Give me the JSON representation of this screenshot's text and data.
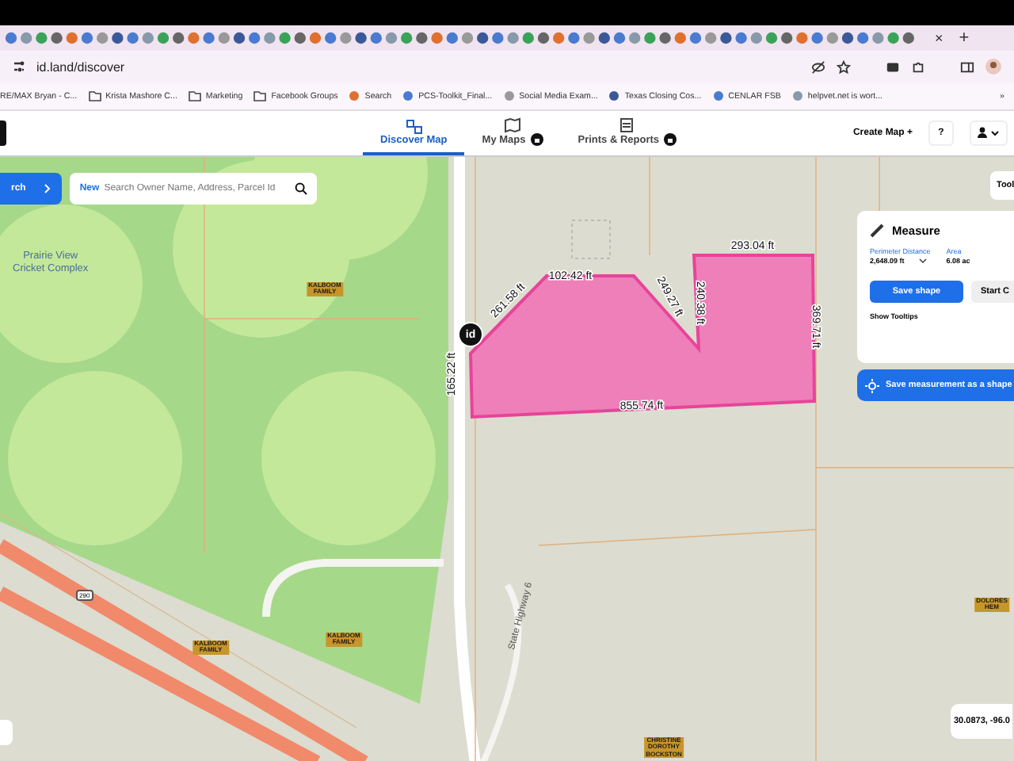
{
  "browser": {
    "tab_close": "×",
    "new_tab": "+",
    "url": "id.land/discover",
    "bookmarks": [
      "RE/MAX Bryan - C...",
      "Krista Mashore C...",
      "Marketing",
      "Facebook Groups",
      "Search",
      "PCS-Toolkit_Final...",
      "Social Media Exam...",
      "Texas Closing Cos...",
      "CENLAR FSB",
      "helpvet.net is wort..."
    ],
    "bookmarks_more": "»"
  },
  "header": {
    "tabs": [
      {
        "label": "Discover Map",
        "selected": true,
        "locked": false
      },
      {
        "label": "My Maps",
        "selected": false,
        "locked": true
      },
      {
        "label": "Prints & Reports",
        "selected": false,
        "locked": true
      }
    ],
    "create_map": "Create Map",
    "create_map_icon": "+",
    "help": "?"
  },
  "search": {
    "button": "rch",
    "tag": "New",
    "placeholder": "Search Owner Name, Address, Parcel Id"
  },
  "tools_button": "Tool",
  "measure": {
    "title": "Measure",
    "perimeter_label": "Perimeter Distance",
    "perimeter_value": "2,648.09 ft",
    "area_label": "Area",
    "area_value": "6.08 ac",
    "save_button": "Save shape",
    "start_button": "Start C",
    "tooltips": "Show Tooltips",
    "banner": "Save measurement as a shape"
  },
  "map": {
    "place_label": [
      "Prairie View",
      "Cricket Complex"
    ],
    "edge_labels": [
      "165.22 ft",
      "261.58 ft",
      "102.42 ft",
      "249.27 ft",
      "240.38 ft",
      "293.04 ft",
      "369.71 ft",
      "855.74 ft"
    ],
    "owner_labels": [
      [
        "KALBOOM",
        "FAMILY"
      ],
      [
        "KALBOOM",
        "FAMILY"
      ],
      [
        "KALBOOM",
        "FAMILY"
      ],
      [
        "DOLORES",
        "HEM"
      ],
      [
        "CHRISTINE",
        "DOROTHY",
        "BOCKSTON"
      ]
    ],
    "road_label": "State Highway 6",
    "route_shield": "290",
    "pin": "id",
    "coordinates": "30.0873, -96.0"
  }
}
